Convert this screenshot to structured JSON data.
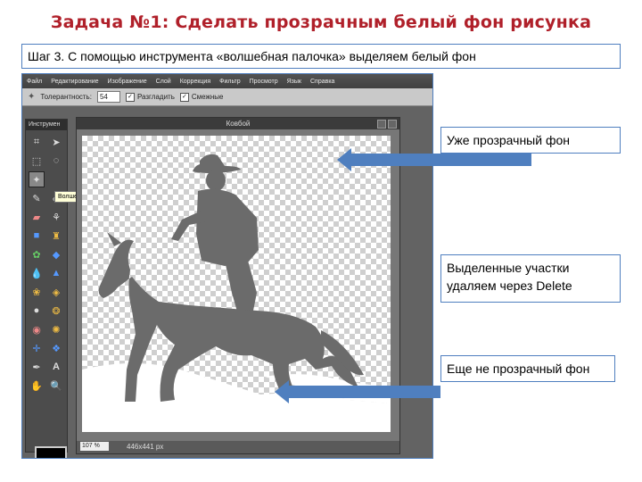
{
  "slide": {
    "title": "Задача №1: Сделать прозрачным белый фон рисунка",
    "step_text": "Шаг 3. С помощью инструмента «волшебная палочка» выделяем белый фон"
  },
  "editor": {
    "menu": [
      "Файл",
      "Редактирование",
      "Изображение",
      "Слой",
      "Коррекция",
      "Фильтр",
      "Просмотр",
      "Язык",
      "Справка"
    ],
    "options": {
      "tolerance_label": "Толерантность:",
      "tolerance_value": "54",
      "antialias_label": "Разгладить",
      "contiguous_label": "Смежные"
    },
    "tools_panel_title": "Инструмен",
    "tooltip": "Волшебная палочка (W)",
    "document_title": "Ковбой",
    "status": {
      "zoom": "107 %",
      "dimensions": "446x441 px"
    },
    "tool_icons": [
      "crop-icon",
      "move-icon",
      "marquee-icon",
      "lasso-icon",
      "magic-wand-icon",
      "pencil-icon",
      "brush-icon",
      "eraser-icon",
      "clone-icon",
      "gradient-icon",
      "stamp-icon",
      "replace-color-icon",
      "blur-icon",
      "sharpen-icon",
      "sponge-icon",
      "dodge-icon",
      "burn-icon",
      "red-eye-icon",
      "spot-heal-icon",
      "bloat-icon",
      "pinch-icon",
      "color-picker-icon",
      "type-icon",
      "hand-icon",
      "zoom-icon"
    ]
  },
  "callouts": {
    "transparent": "Уже прозрачный фон",
    "selected": "Выделенные участки удаляем через Delete",
    "not_transparent": "Еще не прозрачный фон"
  },
  "colors": {
    "title": "#b0202a",
    "box_border": "#4f7fbf",
    "arrow": "#4f7fbf",
    "silhouette": "#6b6b6b"
  }
}
